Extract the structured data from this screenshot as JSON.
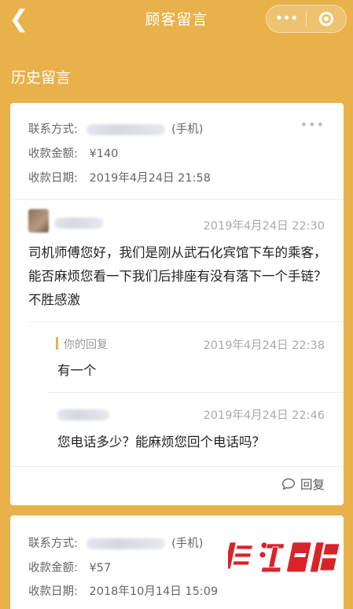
{
  "header": {
    "title": "顾客留言",
    "back_icon": "chevron-left-icon",
    "more": "•••"
  },
  "section_title": "历史留言",
  "cards": [
    {
      "contact_label": "联系方式:",
      "contact_suffix": "(手机)",
      "amount_label": "收款金额:",
      "amount": "¥140",
      "date_label": "收款日期:",
      "date": "2019年4月24日 21:58",
      "more": "•••",
      "message": {
        "date": "2019年4月24日 22:30",
        "text": "司机师傅您好，我们是刚从武石化宾馆下车的乘客，能否麻烦您看一下我们后排座有没有落下一个手链？不胜感激"
      },
      "reply": {
        "label": "你的回复",
        "date": "2019年4月24日 22:38",
        "text": "有一个"
      },
      "followup": {
        "date": "2019年4月24日 22:46",
        "text": "您电话多少？能麻烦您回个电话吗？"
      },
      "reply_button": "回复"
    },
    {
      "contact_label": "联系方式:",
      "contact_suffix": "(手机)",
      "amount_label": "收款金额:",
      "amount": "¥57",
      "date_label": "收款日期:",
      "date": "2018年10月14日 15:09"
    }
  ],
  "watermark": "長江日報",
  "colors": {
    "accent": "#e8b14a",
    "watermark": "#d9232a"
  }
}
